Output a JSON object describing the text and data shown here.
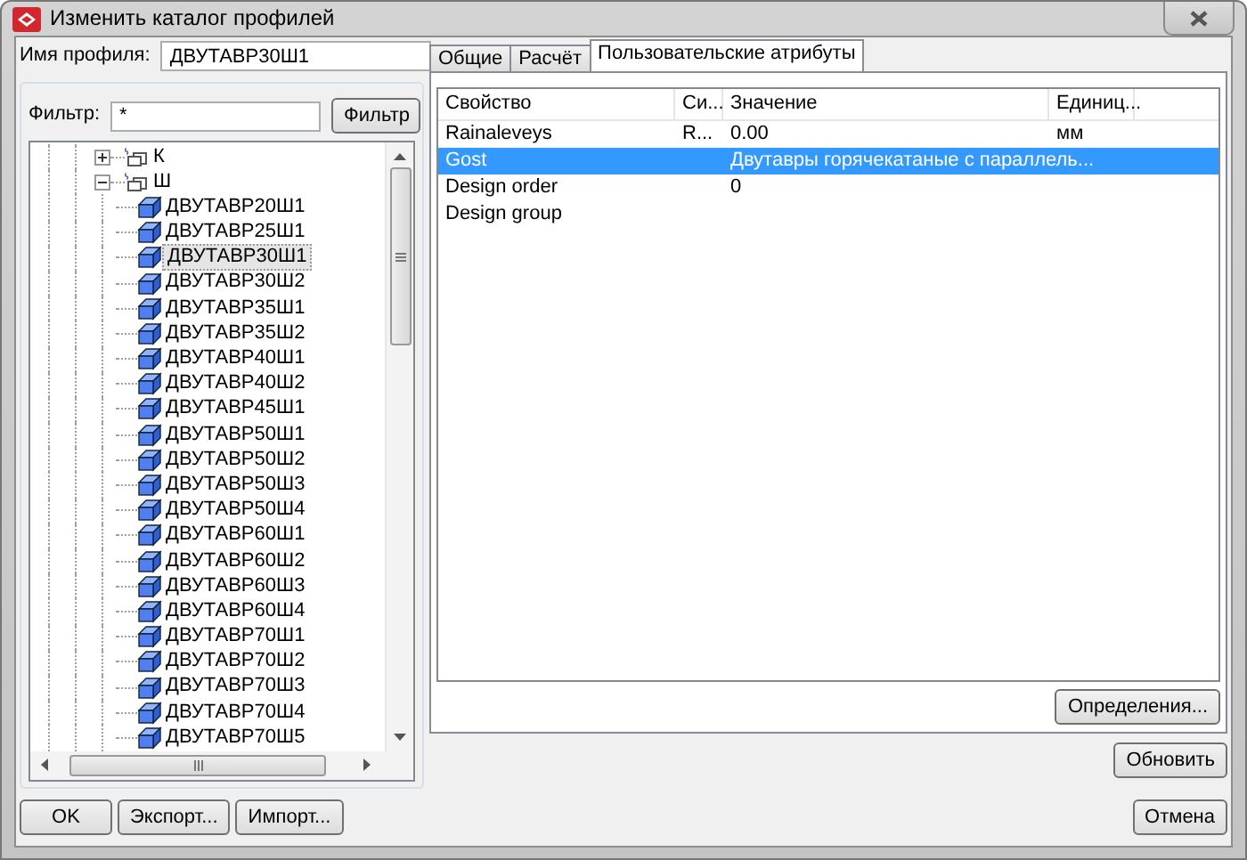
{
  "window": {
    "title": "Изменить каталог профилей"
  },
  "profile_name": {
    "label": "Имя профиля:",
    "value": "ДВУТАВР30Ш1"
  },
  "filter": {
    "label": "Фильтр:",
    "value": "*",
    "button": "Фильтр"
  },
  "tree": [
    {
      "label": "К",
      "expanded": false,
      "selected": false
    },
    {
      "label": "Ш",
      "expanded": true,
      "selected": false,
      "children": [
        {
          "label": "ДВУТАВР20Ш1",
          "selected": false
        },
        {
          "label": "ДВУТАВР25Ш1",
          "selected": false
        },
        {
          "label": "ДВУТАВР30Ш1",
          "selected": true
        },
        {
          "label": "ДВУТАВР30Ш2",
          "selected": false
        },
        {
          "label": "ДВУТАВР35Ш1",
          "selected": false
        },
        {
          "label": "ДВУТАВР35Ш2",
          "selected": false
        },
        {
          "label": "ДВУТАВР40Ш1",
          "selected": false
        },
        {
          "label": "ДВУТАВР40Ш2",
          "selected": false
        },
        {
          "label": "ДВУТАВР45Ш1",
          "selected": false
        },
        {
          "label": "ДВУТАВР50Ш1",
          "selected": false
        },
        {
          "label": "ДВУТАВР50Ш2",
          "selected": false
        },
        {
          "label": "ДВУТАВР50Ш3",
          "selected": false
        },
        {
          "label": "ДВУТАВР50Ш4",
          "selected": false
        },
        {
          "label": "ДВУТАВР60Ш1",
          "selected": false
        },
        {
          "label": "ДВУТАВР60Ш2",
          "selected": false
        },
        {
          "label": "ДВУТАВР60Ш3",
          "selected": false
        },
        {
          "label": "ДВУТАВР60Ш4",
          "selected": false
        },
        {
          "label": "ДВУТАВР70Ш1",
          "selected": false
        },
        {
          "label": "ДВУТАВР70Ш2",
          "selected": false
        },
        {
          "label": "ДВУТАВР70Ш3",
          "selected": false
        },
        {
          "label": "ДВУТАВР70Ш4",
          "selected": false
        },
        {
          "label": "ДВУТАВР70Ш5",
          "selected": false
        }
      ]
    }
  ],
  "tabs": [
    {
      "label": "Общие",
      "selected": false
    },
    {
      "label": "Расчёт",
      "selected": false
    },
    {
      "label": "Пользовательские атрибуты",
      "selected": true
    }
  ],
  "table": {
    "columns": [
      "Свойство",
      "Си...",
      "Значение",
      "Единиц..."
    ],
    "rows": [
      {
        "cells": [
          "Rainaleveys",
          "R...",
          "0.00",
          "мм"
        ],
        "selected": false
      },
      {
        "cells": [
          "Gost",
          "",
          "Двутавры горячекатаные с параллель...",
          ""
        ],
        "selected": true
      },
      {
        "cells": [
          "Design order",
          "",
          "0",
          ""
        ],
        "selected": false
      },
      {
        "cells": [
          "Design group",
          "",
          "",
          ""
        ],
        "selected": false
      }
    ]
  },
  "definitions_button": "Определения...",
  "update_button": "Обновить",
  "footer_buttons": {
    "left": [
      "OK",
      "Экспорт...",
      "Импорт..."
    ],
    "right": [
      "Отмена"
    ]
  }
}
